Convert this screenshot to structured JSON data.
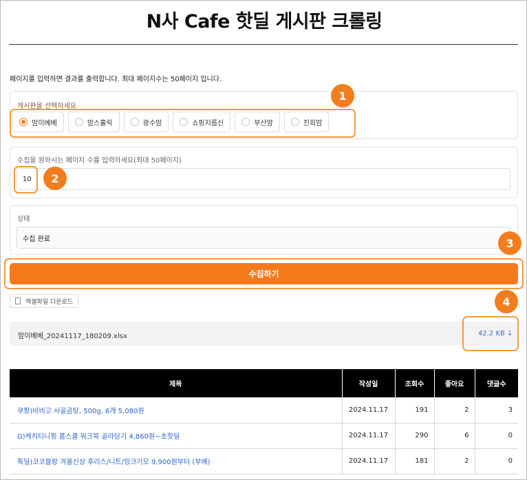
{
  "page": {
    "title": "N사 Cafe 핫딜 게시판 크롤링",
    "notice": "페이지를 입력하면 결과를 출력합니다. 최대 페이지수는 50페이지 입니다."
  },
  "board": {
    "label": "게시판을 선택하세요",
    "options": [
      "맘이베베",
      "맘스홀릭",
      "광수맘",
      "쇼핑지름신",
      "부산맘",
      "진희맘"
    ],
    "selected": "맘이베베"
  },
  "pages": {
    "label": "수집을 원하시는 페이지 수를 입력하세요(최대 50페이지)",
    "value": "10"
  },
  "status": {
    "label": "상태",
    "value": "수집 완료"
  },
  "actions": {
    "collect_label": "수집하기",
    "download_label": "엑셀파일 다운로드"
  },
  "file": {
    "name": "맘이베베_20241117_180209.xlsx",
    "size": "42.2 KB ↓"
  },
  "annotations": [
    "1",
    "2",
    "3",
    "4"
  ],
  "table": {
    "headers": [
      "제목",
      "작성일",
      "조회수",
      "좋아요",
      "댓글수"
    ],
    "rows": [
      {
        "title": "쿠팡)비비고 사골곰탕, 500g, 6개 5,080원",
        "date": "2024.11.17",
        "views": "191",
        "likes": "2",
        "comments": "3"
      },
      {
        "title": "G)케치티니핑 홈스쿨 워크북 골라담기 4,860원~초핫딜",
        "date": "2024.11.17",
        "views": "290",
        "likes": "6",
        "comments": "0"
      },
      {
        "title": "톡딜)코코블랑 겨울신상 후리스/니트/밍크기모 9,900원부터 (부배)",
        "date": "2024.11.17",
        "views": "181",
        "likes": "2",
        "comments": "0"
      }
    ]
  },
  "colors": {
    "accent": "#f57a1b",
    "link": "#2a62c9",
    "header_bg": "#000000"
  }
}
